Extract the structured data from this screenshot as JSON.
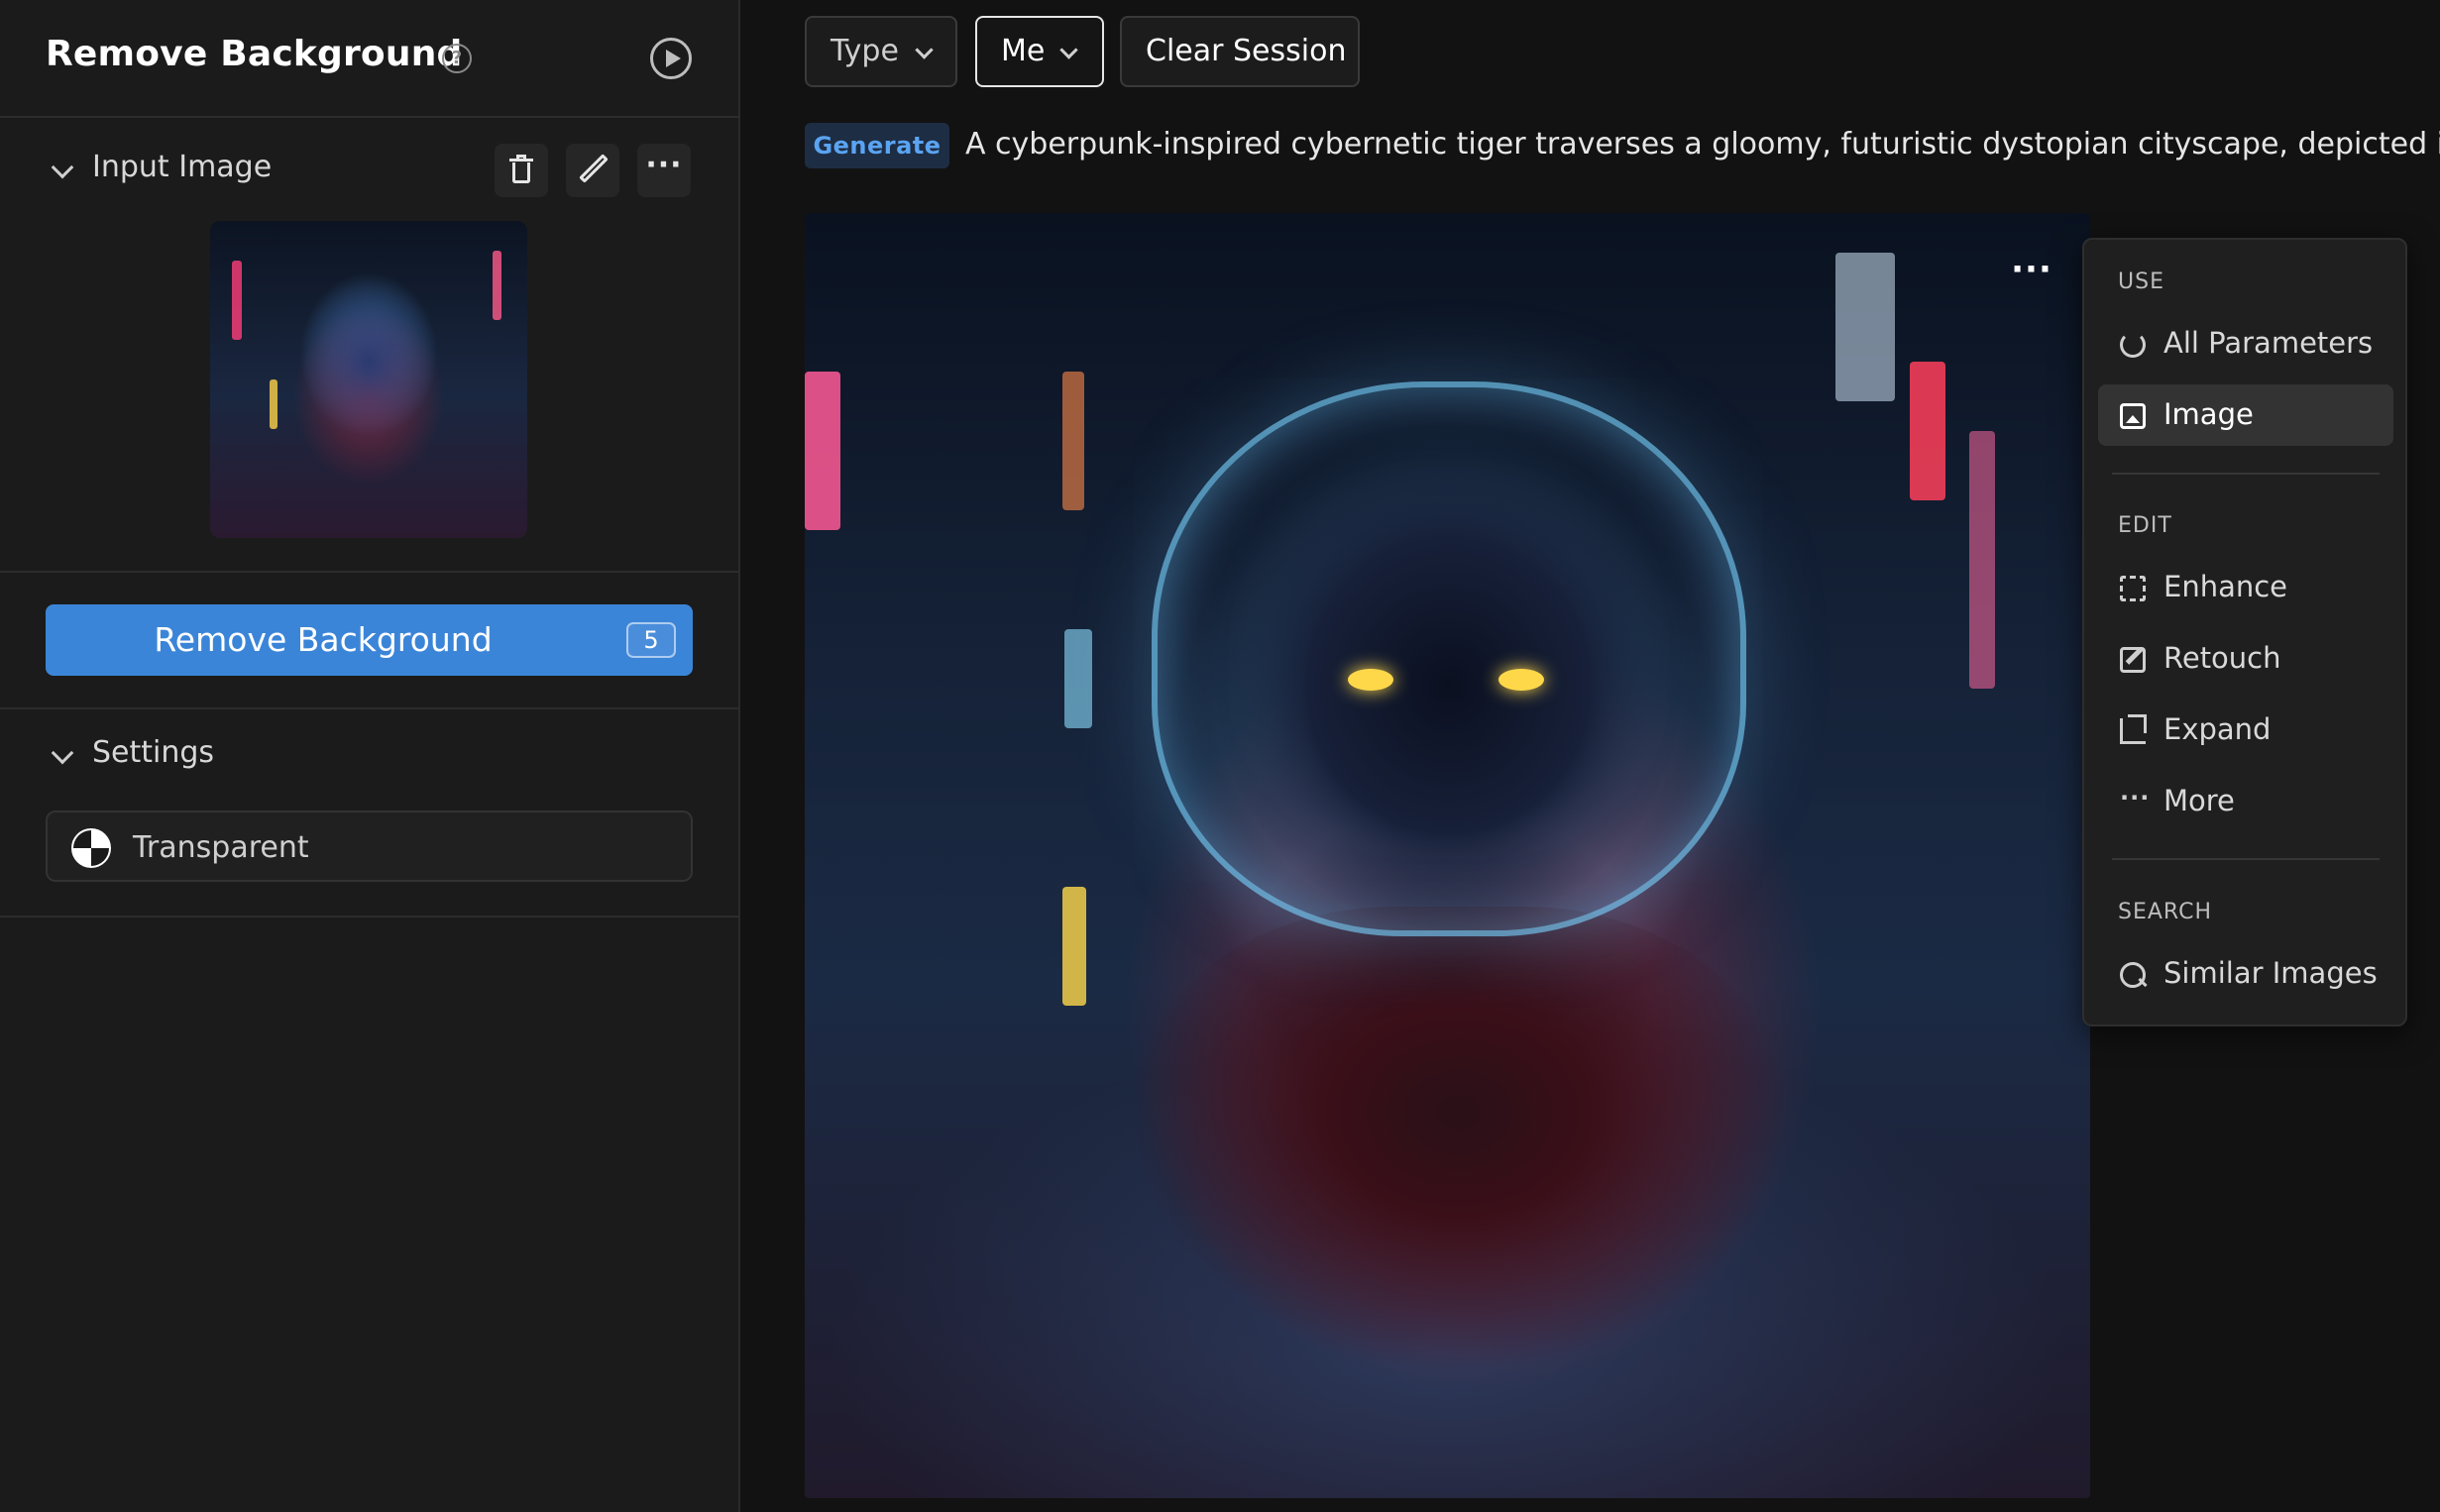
{
  "sidebar": {
    "title": "Remove Background",
    "input_section": {
      "label": "Input Image"
    },
    "primary_button": {
      "label": "Remove Background",
      "count": "5"
    },
    "settings_section": {
      "label": "Settings",
      "background_option": "Transparent"
    }
  },
  "toolbar": {
    "type_label": "Type",
    "owner_label": "Me",
    "clear_label": "Clear Session"
  },
  "prompt": {
    "badge": "Generate",
    "text": "A cyberpunk-inspired cybernetic tiger traverses a gloomy, futuristic dystopian cityscape, depicted in neon"
  },
  "context_menu": {
    "use_heading": "USE",
    "use_items": [
      "All Parameters",
      "Image"
    ],
    "edit_heading": "EDIT",
    "edit_items": [
      "Enhance",
      "Retouch",
      "Expand",
      "More"
    ],
    "search_heading": "SEARCH",
    "search_items": [
      "Similar Images"
    ]
  },
  "colors": {
    "accent": "#3b85d8",
    "badge_text": "#5aa4f2",
    "background": "#121212",
    "panel": "#1b1b1b"
  },
  "icons": [
    "help-icon",
    "play-icon",
    "chevron-down-icon",
    "trash-icon",
    "pencil-icon",
    "more-icon",
    "transparent-icon",
    "refresh-icon",
    "image-icon",
    "enhance-icon",
    "retouch-icon",
    "expand-icon",
    "search-icon"
  ]
}
